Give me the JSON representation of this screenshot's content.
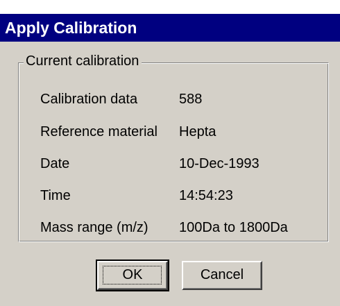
{
  "dialog": {
    "title": "Apply Calibration"
  },
  "group": {
    "label": "Current calibration",
    "rows": [
      {
        "label": "Calibration data",
        "value": "588"
      },
      {
        "label": "Reference material",
        "value": "Hepta"
      },
      {
        "label": "Date",
        "value": "10-Dec-1993"
      },
      {
        "label": "Time",
        "value": "14:54:23"
      },
      {
        "label": "Mass range (m/z)",
        "value": "100Da to 1800Da"
      }
    ]
  },
  "buttons": {
    "ok_label": "OK",
    "cancel_label": "Cancel"
  },
  "colors": {
    "titlebar": "#000080",
    "face": "#d4d0c8"
  }
}
